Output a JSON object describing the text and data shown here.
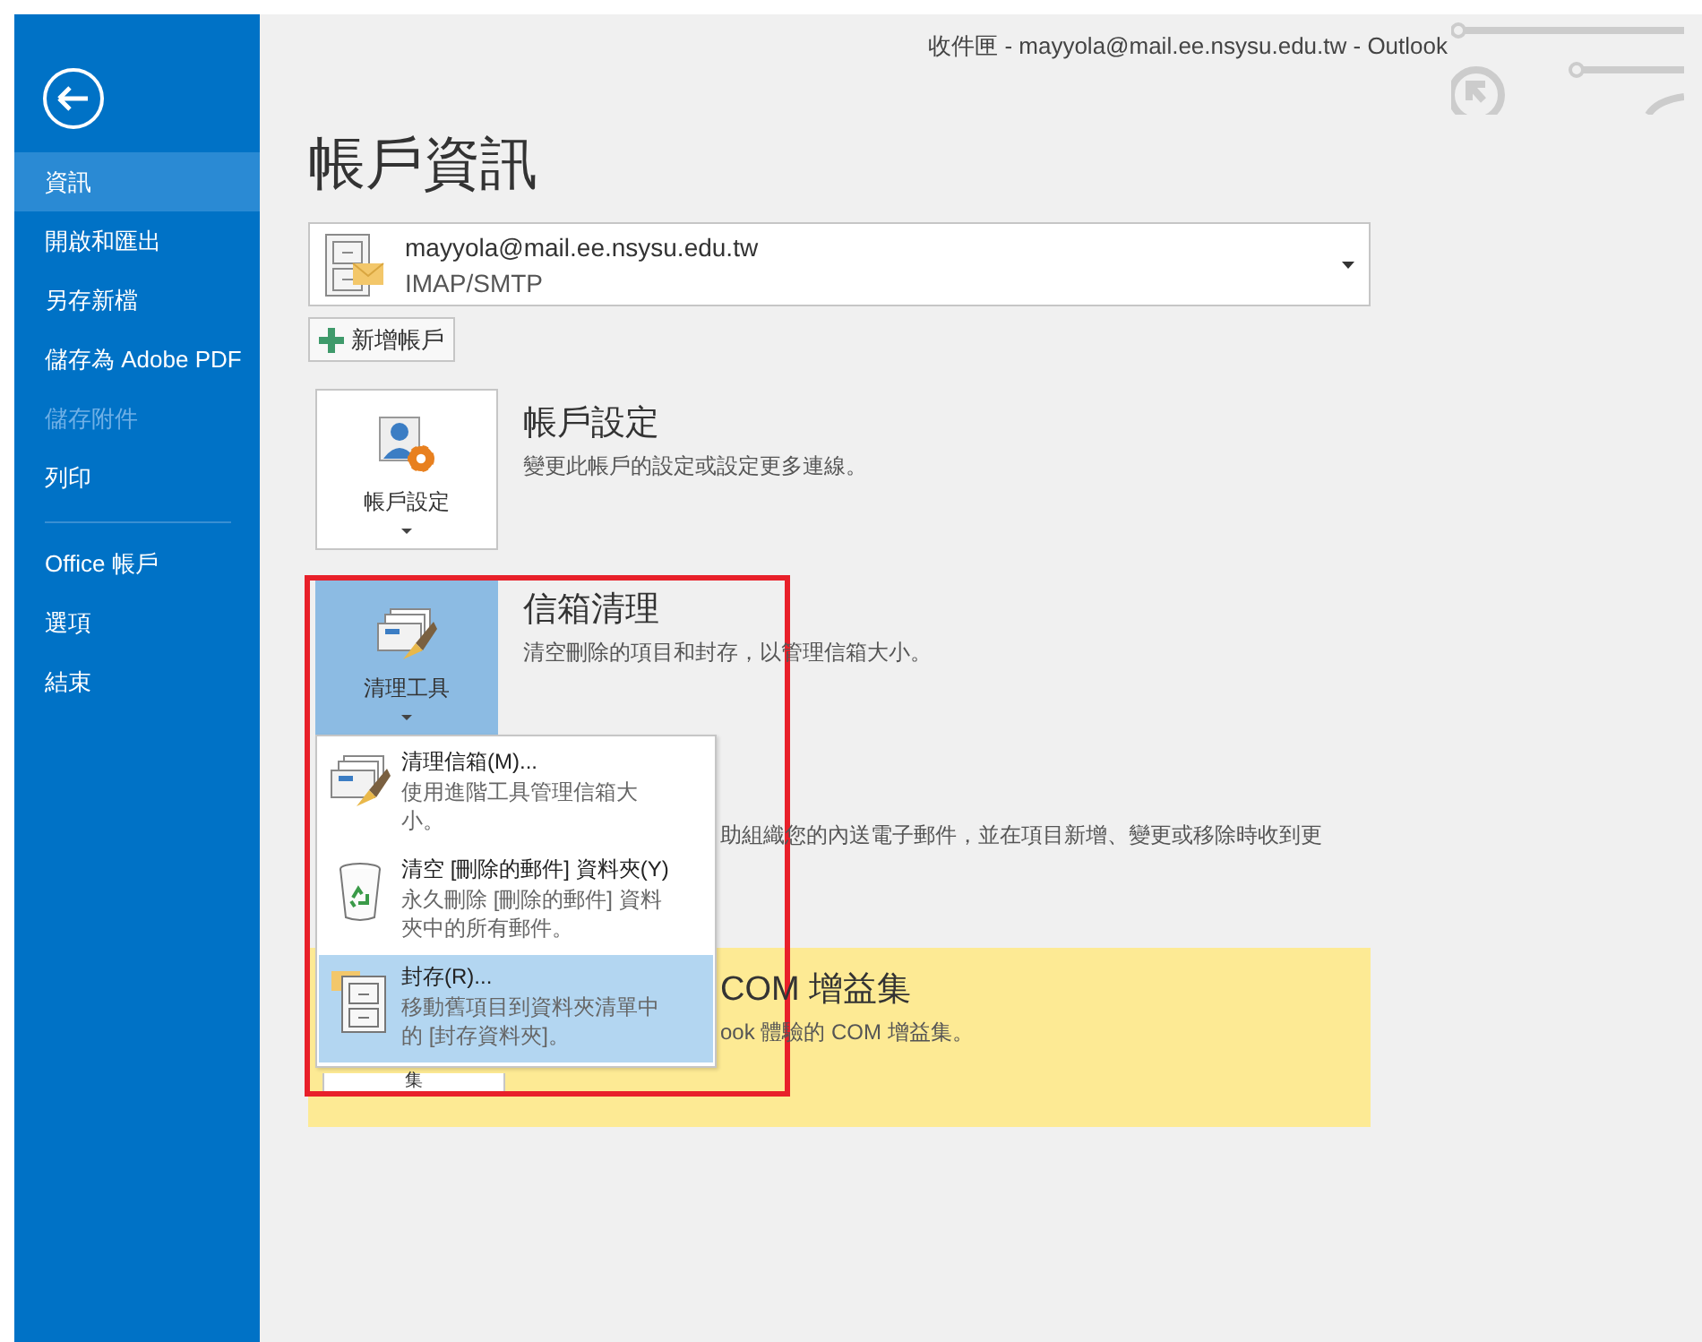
{
  "window": {
    "title": "收件匣 - mayyola@mail.ee.nsysu.edu.tw - Outlook"
  },
  "sidebar": {
    "groups": [
      [
        {
          "label": "資訊",
          "selected": true,
          "disabled": false
        },
        {
          "label": "開啟和匯出",
          "selected": false,
          "disabled": false
        },
        {
          "label": "另存新檔",
          "selected": false,
          "disabled": false
        },
        {
          "label": "儲存為 Adobe PDF",
          "selected": false,
          "disabled": false
        },
        {
          "label": "儲存附件",
          "selected": false,
          "disabled": true
        },
        {
          "label": "列印",
          "selected": false,
          "disabled": false
        }
      ],
      [
        {
          "label": "Office 帳戶",
          "selected": false,
          "disabled": false
        },
        {
          "label": "選項",
          "selected": false,
          "disabled": false
        },
        {
          "label": "結束",
          "selected": false,
          "disabled": false
        }
      ]
    ]
  },
  "page_title": "帳戶資訊",
  "account": {
    "email": "mayyola@mail.ee.nsysu.edu.tw",
    "type": "IMAP/SMTP"
  },
  "add_account_button": "新增帳戶",
  "sections": [
    {
      "kind": "settings",
      "button_label": "帳戶設定",
      "button_pressed": false,
      "title": "帳戶設定",
      "description": "變更此帳戶的設定或設定更多連線。",
      "highlighted": false
    },
    {
      "kind": "cleanup",
      "button_label": "清理工具",
      "button_pressed": true,
      "title": "信箱清理",
      "description": "清空刪除的項目和封存，以管理信箱大小。",
      "highlighted": false
    },
    {
      "kind": "hidden",
      "description": "助組織您的內送電子郵件，並在項目新增、變更或移除時收到更",
      "highlighted": false
    },
    {
      "kind": "partly_hidden",
      "button_label": "集",
      "title": "COM 增益集",
      "description": "ook 體驗的 COM 增益集。",
      "highlighted": true
    }
  ],
  "menu": {
    "items": [
      {
        "kind": "cleanup",
        "title": "清理信箱(M)...",
        "description": "使用進階工具管理信箱大小。",
        "selected": false
      },
      {
        "kind": "recycle",
        "title": "清空 [刪除的郵件] 資料夾(Y)",
        "description": "永久刪除 [刪除的郵件] 資料夾中的所有郵件。",
        "selected": false
      },
      {
        "kind": "archive",
        "title": "封存(R)...",
        "description": "移動舊項目到資料夾清單中的 [封存資料夾]。",
        "selected": true
      }
    ]
  }
}
